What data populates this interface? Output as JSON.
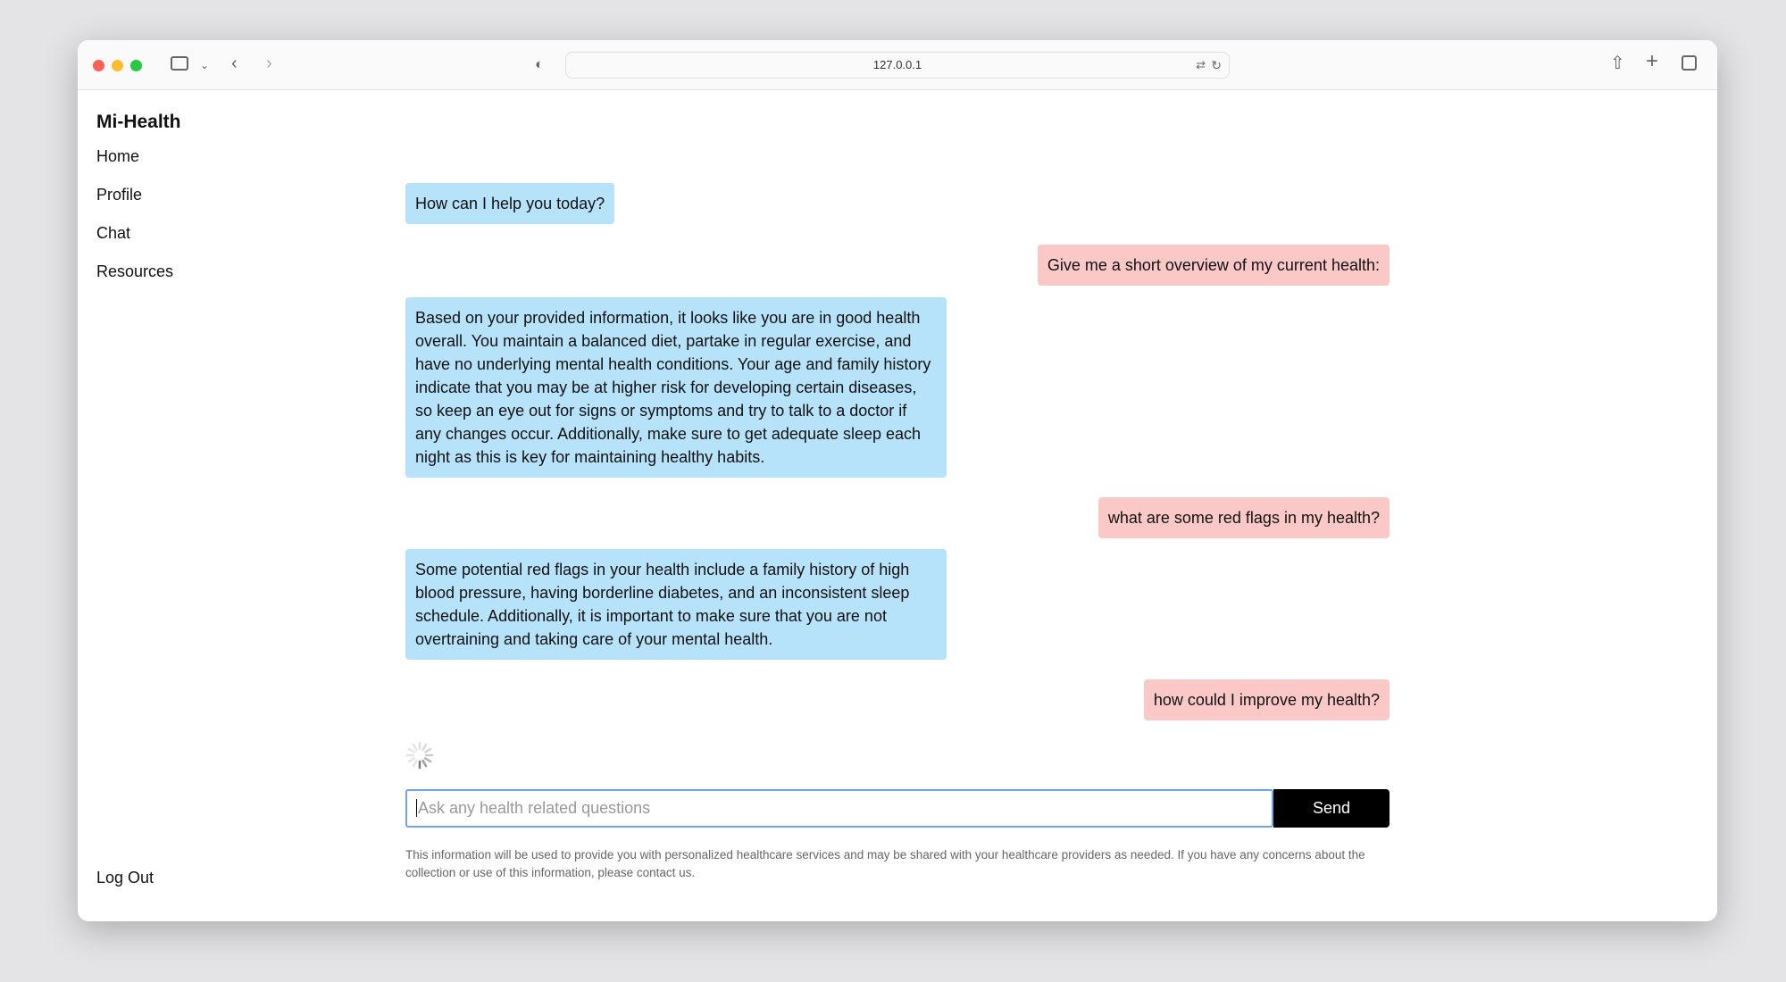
{
  "browser": {
    "url": "127.0.0.1"
  },
  "sidebar": {
    "title": "Mi-Health",
    "items": [
      {
        "label": "Home"
      },
      {
        "label": "Profile"
      },
      {
        "label": "Chat"
      },
      {
        "label": "Resources"
      }
    ],
    "logout": "Log Out"
  },
  "chat": {
    "messages": [
      {
        "role": "bot",
        "text": "How can I help you today?"
      },
      {
        "role": "user",
        "text": "Give me a short overview of my current health:"
      },
      {
        "role": "bot",
        "text": "Based on your provided information, it looks like you are in good health overall. You maintain a balanced diet, partake in regular exercise, and have no underlying mental health conditions. Your age and family history indicate that you may be at higher risk for developing certain diseases, so keep an eye out for signs or symptoms and try to talk to a doctor if any changes occur. Additionally, make sure to get adequate sleep each night as this is key for maintaining healthy habits."
      },
      {
        "role": "user",
        "text": "what are some red flags in my health?"
      },
      {
        "role": "bot",
        "text": "Some potential red flags in your health include a family history of high blood pressure, having borderline diabetes, and an inconsistent sleep schedule. Additionally, it is important to make sure that you are not overtraining and taking care of your mental health."
      },
      {
        "role": "user",
        "text": "how could I improve my health?"
      }
    ],
    "loading": true,
    "input_placeholder": "Ask any health related questions",
    "input_value": "",
    "send_label": "Send",
    "disclaimer": "This information will be used to provide you with personalized healthcare services and may be shared with your healthcare providers as needed. If you have any concerns about the collection or use of this information, please contact us."
  },
  "colors": {
    "bot_bubble": "#b6e2fa",
    "user_bubble": "#fbc8c8",
    "send_button": "#000000",
    "input_focus": "#6fa4e8"
  }
}
